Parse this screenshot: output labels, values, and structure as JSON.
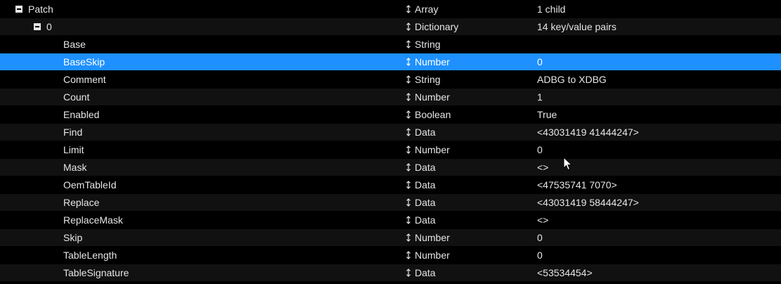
{
  "colors": {
    "background": "#000000",
    "stripe": "#111111",
    "selection": "#1e90ff",
    "text": "#e6e6e6"
  },
  "icons": {
    "expand": "collapse-minus-icon",
    "type": "up-down-arrow-icon",
    "pointer": "mouse-cursor-icon"
  },
  "rows": [
    {
      "key": "Patch",
      "type": "Array",
      "value": "1 child",
      "level": 0,
      "expandable": true,
      "selected": false
    },
    {
      "key": "0",
      "type": "Dictionary",
      "value": "14 key/value pairs",
      "level": 1,
      "expandable": true,
      "selected": false
    },
    {
      "key": "Base",
      "type": "String",
      "value": "",
      "level": 2,
      "expandable": false,
      "selected": false
    },
    {
      "key": "BaseSkip",
      "type": "Number",
      "value": "0",
      "level": 2,
      "expandable": false,
      "selected": true
    },
    {
      "key": "Comment",
      "type": "String",
      "value": "ADBG to XDBG",
      "level": 2,
      "expandable": false,
      "selected": false
    },
    {
      "key": "Count",
      "type": "Number",
      "value": "1",
      "level": 2,
      "expandable": false,
      "selected": false
    },
    {
      "key": "Enabled",
      "type": "Boolean",
      "value": "True",
      "level": 2,
      "expandable": false,
      "selected": false
    },
    {
      "key": "Find",
      "type": "Data",
      "value": "<43031419 41444247>",
      "level": 2,
      "expandable": false,
      "selected": false
    },
    {
      "key": "Limit",
      "type": "Number",
      "value": "0",
      "level": 2,
      "expandable": false,
      "selected": false
    },
    {
      "key": "Mask",
      "type": "Data",
      "value": "<>",
      "level": 2,
      "expandable": false,
      "selected": false
    },
    {
      "key": "OemTableId",
      "type": "Data",
      "value": "<47535741 7070>",
      "level": 2,
      "expandable": false,
      "selected": false
    },
    {
      "key": "Replace",
      "type": "Data",
      "value": "<43031419 58444247>",
      "level": 2,
      "expandable": false,
      "selected": false
    },
    {
      "key": "ReplaceMask",
      "type": "Data",
      "value": "<>",
      "level": 2,
      "expandable": false,
      "selected": false
    },
    {
      "key": "Skip",
      "type": "Number",
      "value": "0",
      "level": 2,
      "expandable": false,
      "selected": false
    },
    {
      "key": "TableLength",
      "type": "Number",
      "value": "0",
      "level": 2,
      "expandable": false,
      "selected": false
    },
    {
      "key": "TableSignature",
      "type": "Data",
      "value": "<53534454>",
      "level": 2,
      "expandable": false,
      "selected": false
    }
  ]
}
